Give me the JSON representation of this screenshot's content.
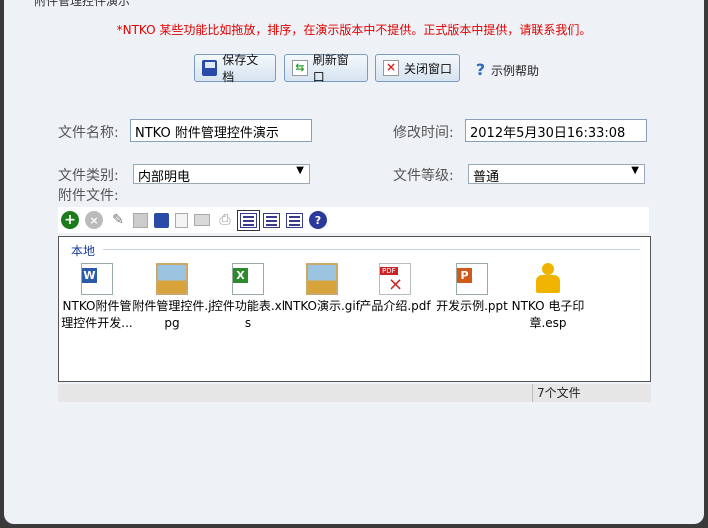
{
  "window": {
    "title": "附件管理控件演示"
  },
  "notice": "*NTKO 某些功能比如拖放，排序，在演示版本中不提供。正式版本中提供，请联系我们。",
  "buttons": {
    "save": "保存文档",
    "refresh": "刷新窗口",
    "close": "关闭窗口"
  },
  "help": {
    "label": "示例帮助"
  },
  "form": {
    "doc_name_label": "文件名称:",
    "doc_name_value": "NTKO 附件管理控件演示",
    "modified_label": "修改时间:",
    "modified_value": "2012年5月30日16:33:08",
    "category_label": "文件类别:",
    "category_value": "内部明电",
    "level_label": "文件等级:",
    "level_value": "普通",
    "attachments_label": "附件文件:"
  },
  "file_panel": {
    "group_label": "本地",
    "files": [
      {
        "name": "NTKO附件管理控件开发...",
        "icon": "word-doc-icon"
      },
      {
        "name": "附件管理控件.jpg",
        "icon": "image-icon"
      },
      {
        "name": "控件功能表.xls",
        "icon": "excel-icon"
      },
      {
        "name": "NTKO演示.gif",
        "icon": "image-icon"
      },
      {
        "name": "产品介绍.pdf",
        "icon": "pdf-icon"
      },
      {
        "name": "开发示例.ppt",
        "icon": "powerpoint-icon"
      },
      {
        "name": "NTKO 电子印章.esp",
        "icon": "stamp-icon"
      }
    ],
    "status_count": "7个文件"
  }
}
